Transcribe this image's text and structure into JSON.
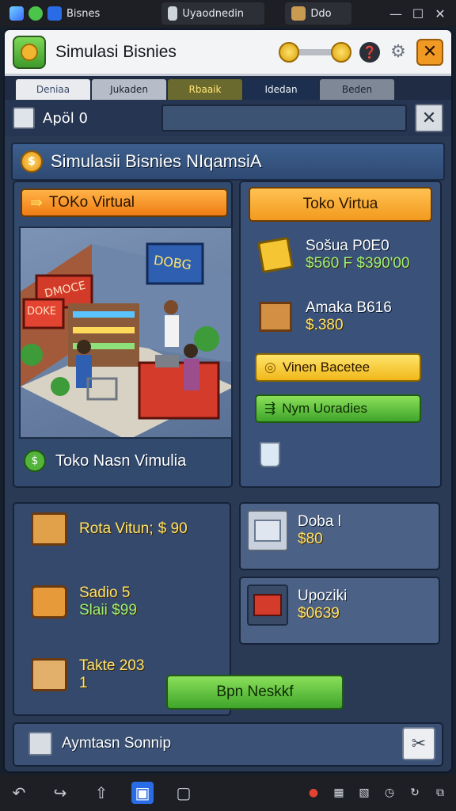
{
  "os_tabs": [
    {
      "label": "Bisnes",
      "active": false
    },
    {
      "label": "Uyaodnedin",
      "active": true
    },
    {
      "label": "Ddo",
      "active": false
    }
  ],
  "app": {
    "title": "Simulasi Bisnies"
  },
  "tabs": [
    "Deniaa",
    "Jukaden",
    "Rbaaik",
    "Idedan",
    "Beden"
  ],
  "search": {
    "label": "Apöl 0",
    "value": ""
  },
  "banner": {
    "title": "Simulasii Bisnies NIqamsiA"
  },
  "left_panel": {
    "title_button": "TOKo Virtual",
    "shop_caption": "Toko Nasn Vimulia",
    "shop_signs": [
      "DMOCE",
      "DOKE",
      "DOBG"
    ]
  },
  "right_panel": {
    "title_button": "Toko Virtua",
    "items": [
      {
        "name": "Sošua P0E0",
        "price": "$560 F $390'00"
      },
      {
        "name": "Amaka B616",
        "price": "$.380"
      }
    ],
    "yellow_button": "Vinen Bacetee",
    "green_button": "Nym Uoradies"
  },
  "bottom_left": {
    "items": [
      {
        "name": "Rota Vitun;",
        "price": "$ 90"
      },
      {
        "name": "Sadio 5",
        "price": "Slaii $99"
      },
      {
        "name": "Takte 203",
        "price": "1"
      }
    ],
    "action_button": "Bpn Neskkf"
  },
  "bottom_right": {
    "items": [
      {
        "name": "Doba l",
        "price": "$80"
      },
      {
        "name": "Upoziki",
        "price": "$0639"
      }
    ]
  },
  "footer": {
    "label": "Aymtasn Sonnip"
  }
}
